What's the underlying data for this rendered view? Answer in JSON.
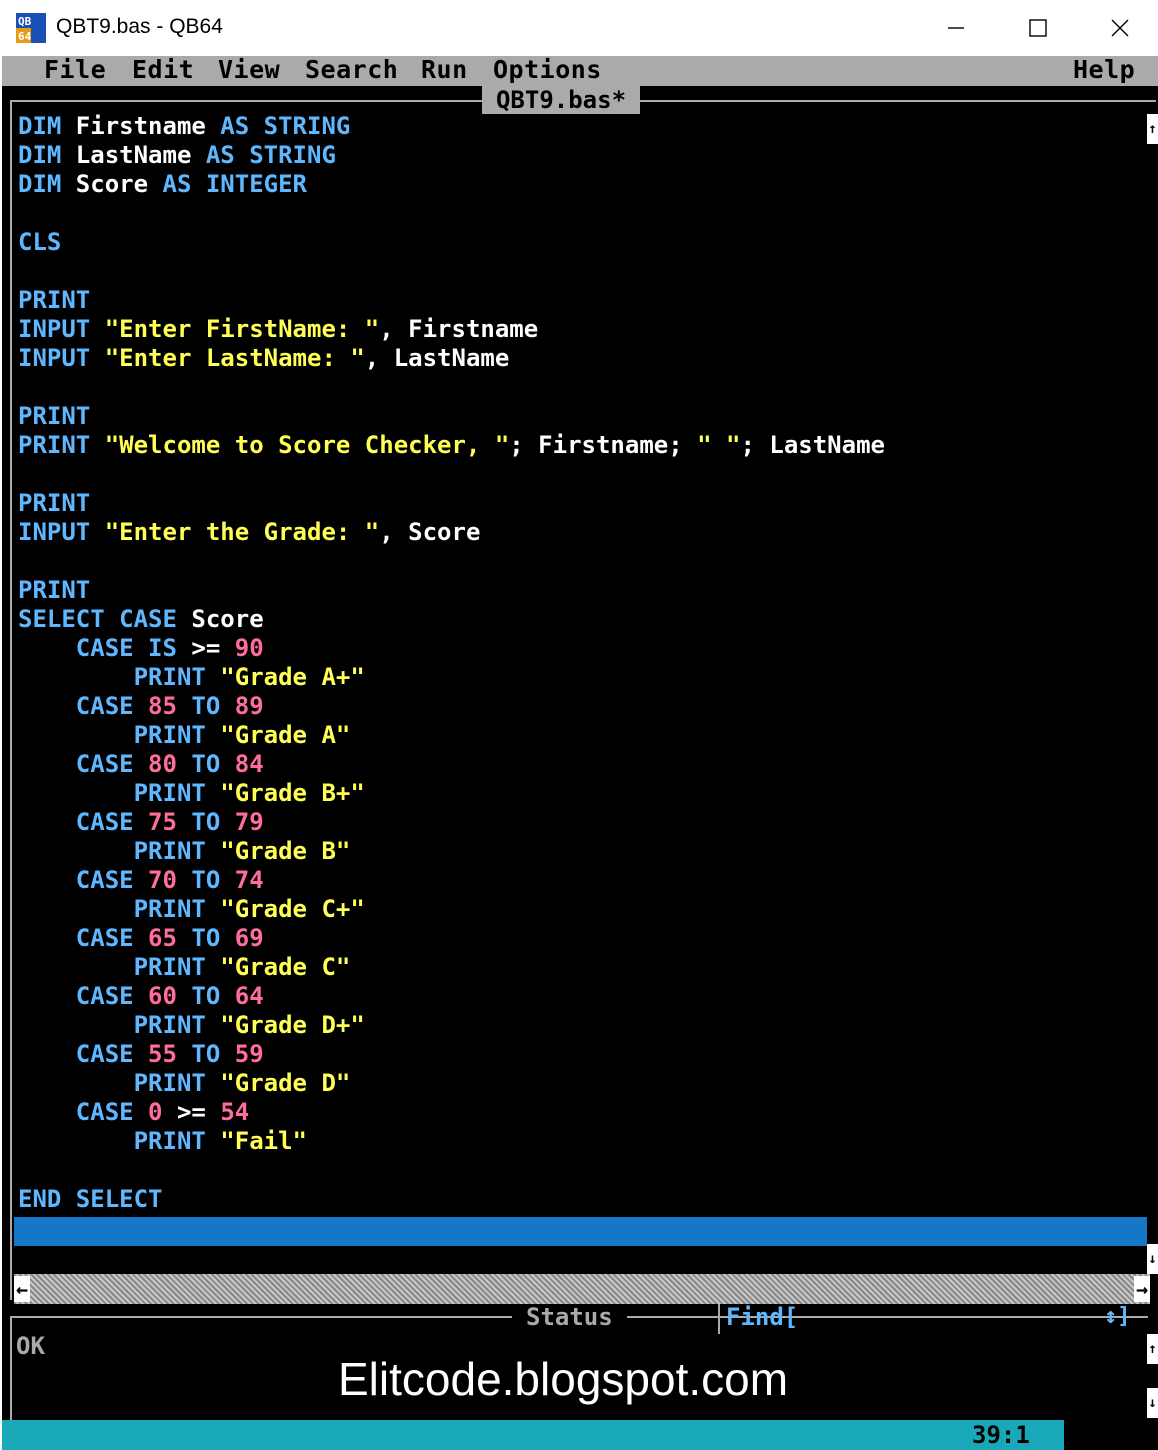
{
  "window": {
    "title": "QBT9.bas - QB64",
    "icon_label": "QB64"
  },
  "menu": [
    "File",
    "Edit",
    "View",
    "Search",
    "Run",
    "Options"
  ],
  "menu_help": "Help",
  "editor": {
    "tab_name": "QBT9.bas*",
    "code": [
      [
        [
          "kw",
          "DIM "
        ],
        [
          "id",
          "Firstname "
        ],
        [
          "kw",
          "AS STRING"
        ]
      ],
      [
        [
          "kw",
          "DIM "
        ],
        [
          "id",
          "LastName "
        ],
        [
          "kw",
          "AS STRING"
        ]
      ],
      [
        [
          "kw",
          "DIM "
        ],
        [
          "id",
          "Score "
        ],
        [
          "kw",
          "AS INTEGER"
        ]
      ],
      [],
      [
        [
          "kw",
          "CLS"
        ]
      ],
      [],
      [
        [
          "kw",
          "PRINT"
        ]
      ],
      [
        [
          "kw",
          "INPUT "
        ],
        [
          "str",
          "\"Enter FirstName: \""
        ],
        [
          "id",
          ", Firstname"
        ]
      ],
      [
        [
          "kw",
          "INPUT "
        ],
        [
          "str",
          "\"Enter LastName: \""
        ],
        [
          "id",
          ", LastName"
        ]
      ],
      [],
      [
        [
          "kw",
          "PRINT"
        ]
      ],
      [
        [
          "kw",
          "PRINT "
        ],
        [
          "str",
          "\"Welcome to Score Checker, \""
        ],
        [
          "id",
          "; Firstname; "
        ],
        [
          "str",
          "\" \""
        ],
        [
          "id",
          "; LastName"
        ]
      ],
      [],
      [
        [
          "kw",
          "PRINT"
        ]
      ],
      [
        [
          "kw",
          "INPUT "
        ],
        [
          "str",
          "\"Enter the Grade: \""
        ],
        [
          "id",
          ", Score"
        ]
      ],
      [],
      [
        [
          "kw",
          "PRINT"
        ]
      ],
      [
        [
          "kw",
          "SELECT CASE "
        ],
        [
          "id",
          "Score"
        ]
      ],
      [
        [
          "kw",
          "    CASE IS "
        ],
        [
          "id",
          ">= "
        ],
        [
          "num",
          "90"
        ]
      ],
      [
        [
          "kw",
          "        PRINT "
        ],
        [
          "str",
          "\"Grade A+\""
        ]
      ],
      [
        [
          "kw",
          "    CASE "
        ],
        [
          "num",
          "85 "
        ],
        [
          "kw",
          "TO "
        ],
        [
          "num",
          "89"
        ]
      ],
      [
        [
          "kw",
          "        PRINT "
        ],
        [
          "str",
          "\"Grade A\""
        ]
      ],
      [
        [
          "kw",
          "    CASE "
        ],
        [
          "num",
          "80 "
        ],
        [
          "kw",
          "TO "
        ],
        [
          "num",
          "84"
        ]
      ],
      [
        [
          "kw",
          "        PRINT "
        ],
        [
          "str",
          "\"Grade B+\""
        ]
      ],
      [
        [
          "kw",
          "    CASE "
        ],
        [
          "num",
          "75 "
        ],
        [
          "kw",
          "TO "
        ],
        [
          "num",
          "79"
        ]
      ],
      [
        [
          "kw",
          "        PRINT "
        ],
        [
          "str",
          "\"Grade B\""
        ]
      ],
      [
        [
          "kw",
          "    CASE "
        ],
        [
          "num",
          "70 "
        ],
        [
          "kw",
          "TO "
        ],
        [
          "num",
          "74"
        ]
      ],
      [
        [
          "kw",
          "        PRINT "
        ],
        [
          "str",
          "\"Grade C+\""
        ]
      ],
      [
        [
          "kw",
          "    CASE "
        ],
        [
          "num",
          "65 "
        ],
        [
          "kw",
          "TO "
        ],
        [
          "num",
          "69"
        ]
      ],
      [
        [
          "kw",
          "        PRINT "
        ],
        [
          "str",
          "\"Grade C\""
        ]
      ],
      [
        [
          "kw",
          "    CASE "
        ],
        [
          "num",
          "60 "
        ],
        [
          "kw",
          "TO "
        ],
        [
          "num",
          "64"
        ]
      ],
      [
        [
          "kw",
          "        PRINT "
        ],
        [
          "str",
          "\"Grade D+\""
        ]
      ],
      [
        [
          "kw",
          "    CASE "
        ],
        [
          "num",
          "55 "
        ],
        [
          "kw",
          "TO "
        ],
        [
          "num",
          "59"
        ]
      ],
      [
        [
          "kw",
          "        PRINT "
        ],
        [
          "str",
          "\"Grade D\""
        ]
      ],
      [
        [
          "kw",
          "    CASE "
        ],
        [
          "num",
          "0 "
        ],
        [
          "id",
          ">= "
        ],
        [
          "num",
          "54"
        ]
      ],
      [
        [
          "kw",
          "        PRINT "
        ],
        [
          "str",
          "\"Fail\""
        ]
      ],
      [],
      [
        [
          "kw",
          "END SELECT"
        ]
      ]
    ]
  },
  "status": {
    "title": "Status",
    "find_label": "Find[",
    "find_arrows": "↕]",
    "message": "OK",
    "watermark": "Elitcode.blogspot.com",
    "cursor_position": "39:1"
  },
  "colors": {
    "keyword": "#5fb8ff",
    "identifier": "#ffffff",
    "string": "#ffff55",
    "number": "#ff6e9a",
    "highlight_line": "#1477c8",
    "status_bar": "#19a8b8"
  }
}
